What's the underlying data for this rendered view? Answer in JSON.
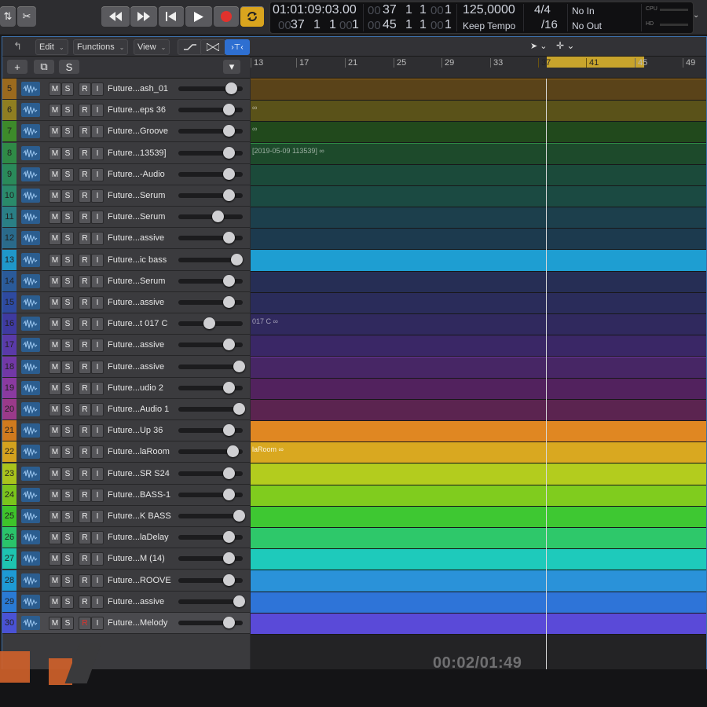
{
  "transport": {
    "rewind_icon": "rewind-icon",
    "forward_icon": "fast-forward-icon",
    "tostart_icon": "go-to-start-icon",
    "play_icon": "play-icon",
    "record_icon": "record-icon",
    "cycle_icon": "cycle-icon"
  },
  "lcd": {
    "time": "01:01:09:03.00",
    "bars_top": [
      "37",
      "1",
      "1"
    ],
    "bars_top_sub": "1",
    "bars_bottom": [
      "37",
      "1",
      "1"
    ],
    "bars_bottom_sub": "1",
    "locator_top": [
      "37",
      "1",
      "1"
    ],
    "locator_top_sub": "1",
    "locator_bottom": [
      "45",
      "1",
      "1"
    ],
    "locator_bottom_sub": "1",
    "dim_left_top": "00",
    "dim_mid_top": "00",
    "dim_left_bottom": "00",
    "dim_mid_bottom": "00",
    "tempo": "125,0000",
    "tempo_mode": "Keep Tempo",
    "signature": "4/4",
    "division": "/16",
    "in": "No In",
    "out": "No Out",
    "cpu_label": "CPU",
    "hd_label": "HD"
  },
  "menus": {
    "edit": "Edit",
    "functions": "Functions",
    "view": "View"
  },
  "header_buttons": {
    "add": "+",
    "s": "S"
  },
  "ruler": [
    "13",
    "17",
    "21",
    "25",
    "29",
    "33",
    "37",
    "41",
    "45",
    "49"
  ],
  "track_buttons": [
    "M",
    "S",
    "R",
    "I"
  ],
  "tracks": [
    {
      "num": "5",
      "name": "Future...ash_01",
      "color": "#9b6a1e",
      "lane": "#5a4319",
      "knob": 0.85,
      "label": ""
    },
    {
      "num": "6",
      "name": "Future...eps 36",
      "color": "#8f7e21",
      "lane": "#5a5219",
      "knob": 0.82,
      "label": "∞"
    },
    {
      "num": "7",
      "name": "Future...Groove",
      "color": "#3d8a2a",
      "lane": "#21491c",
      "knob": 0.82,
      "label": "∞"
    },
    {
      "num": "8",
      "name": "Future...13539]",
      "color": "#2f8a46",
      "lane": "#1d4a2b",
      "knob": 0.82,
      "label": "[2019-05-09 113539]  ∞"
    },
    {
      "num": "9",
      "name": "Future...-Audio",
      "color": "#2a8a5a",
      "lane": "#1b4a3a",
      "knob": 0.82,
      "label": ""
    },
    {
      "num": "10",
      "name": "Future...Serum",
      "color": "#2a8a6a",
      "lane": "#1b4a42",
      "knob": 0.82,
      "label": ""
    },
    {
      "num": "11",
      "name": "Future...Serum",
      "color": "#2a7f85",
      "lane": "#1c3f4c",
      "knob": 0.62,
      "label": ""
    },
    {
      "num": "12",
      "name": "Future...assive",
      "color": "#2a6a8a",
      "lane": "#1c3a4e",
      "knob": 0.82,
      "label": ""
    },
    {
      "num": "13",
      "name": "Future...ic bass",
      "color": "#1f97c9",
      "lane": "#1e9ed2",
      "knob": 0.95,
      "label": ""
    },
    {
      "num": "14",
      "name": "Future...Serum",
      "color": "#2a5a99",
      "lane": "#262e55",
      "knob": 0.82,
      "label": ""
    },
    {
      "num": "15",
      "name": "Future...assive",
      "color": "#2e4aa0",
      "lane": "#2a2c5a",
      "knob": 0.82,
      "label": ""
    },
    {
      "num": "16",
      "name": "Future...t 017 C",
      "color": "#3f3aa0",
      "lane": "#30295e",
      "knob": 0.45,
      "label": "017 C  ∞"
    },
    {
      "num": "17",
      "name": "Future...assive",
      "color": "#5a3aa8",
      "lane": "#3a2766",
      "knob": 0.82,
      "label": ""
    },
    {
      "num": "18",
      "name": "Future...assive",
      "color": "#7238a6",
      "lane": "#472665",
      "knob": 1.0,
      "label": ""
    },
    {
      "num": "19",
      "name": "Future...udio 2",
      "color": "#8a3aa0",
      "lane": "#52225e",
      "knob": 0.82,
      "label": ""
    },
    {
      "num": "20",
      "name": "Future...Audio 1",
      "color": "#9a3a8a",
      "lane": "#5b2450",
      "knob": 1.0,
      "label": ""
    },
    {
      "num": "21",
      "name": "Future...Up 36",
      "color": "#d07a1e",
      "lane": "#e08722",
      "knob": 0.82,
      "label": ""
    },
    {
      "num": "22",
      "name": "Future...laRoom",
      "color": "#d4a21e",
      "lane": "#d9a820",
      "knob": 0.88,
      "label": "laRoom  ∞"
    },
    {
      "num": "23",
      "name": "Future...SR S24",
      "color": "#a9c41c",
      "lane": "#b3cc1e",
      "knob": 0.82,
      "label": ""
    },
    {
      "num": "24",
      "name": "Future...BASS-1",
      "color": "#7ac41c",
      "lane": "#80cc1e",
      "knob": 0.82,
      "label": ""
    },
    {
      "num": "25",
      "name": "Future...K BASS",
      "color": "#3ec42a",
      "lane": "#3ec832",
      "knob": 1.0,
      "label": ""
    },
    {
      "num": "26",
      "name": "Future...laDelay",
      "color": "#2ac46a",
      "lane": "#2ec86a",
      "knob": 0.82,
      "label": ""
    },
    {
      "num": "27",
      "name": "Future...M (14)",
      "color": "#1ec4b0",
      "lane": "#1ecabb",
      "knob": 0.82,
      "label": ""
    },
    {
      "num": "28",
      "name": "Future...ROOVE",
      "color": "#1e9ad4",
      "lane": "#2a92d9",
      "knob": 0.82,
      "label": ""
    },
    {
      "num": "29",
      "name": "Future...assive",
      "color": "#2a7ad4",
      "lane": "#2e74d8",
      "knob": 1.0,
      "label": ""
    },
    {
      "num": "30",
      "name": "Future...Melody",
      "color": "#4a52d4",
      "lane": "#5a4ad8",
      "knob": 0.82,
      "label": ""
    }
  ],
  "timer": "00:02/01:49"
}
